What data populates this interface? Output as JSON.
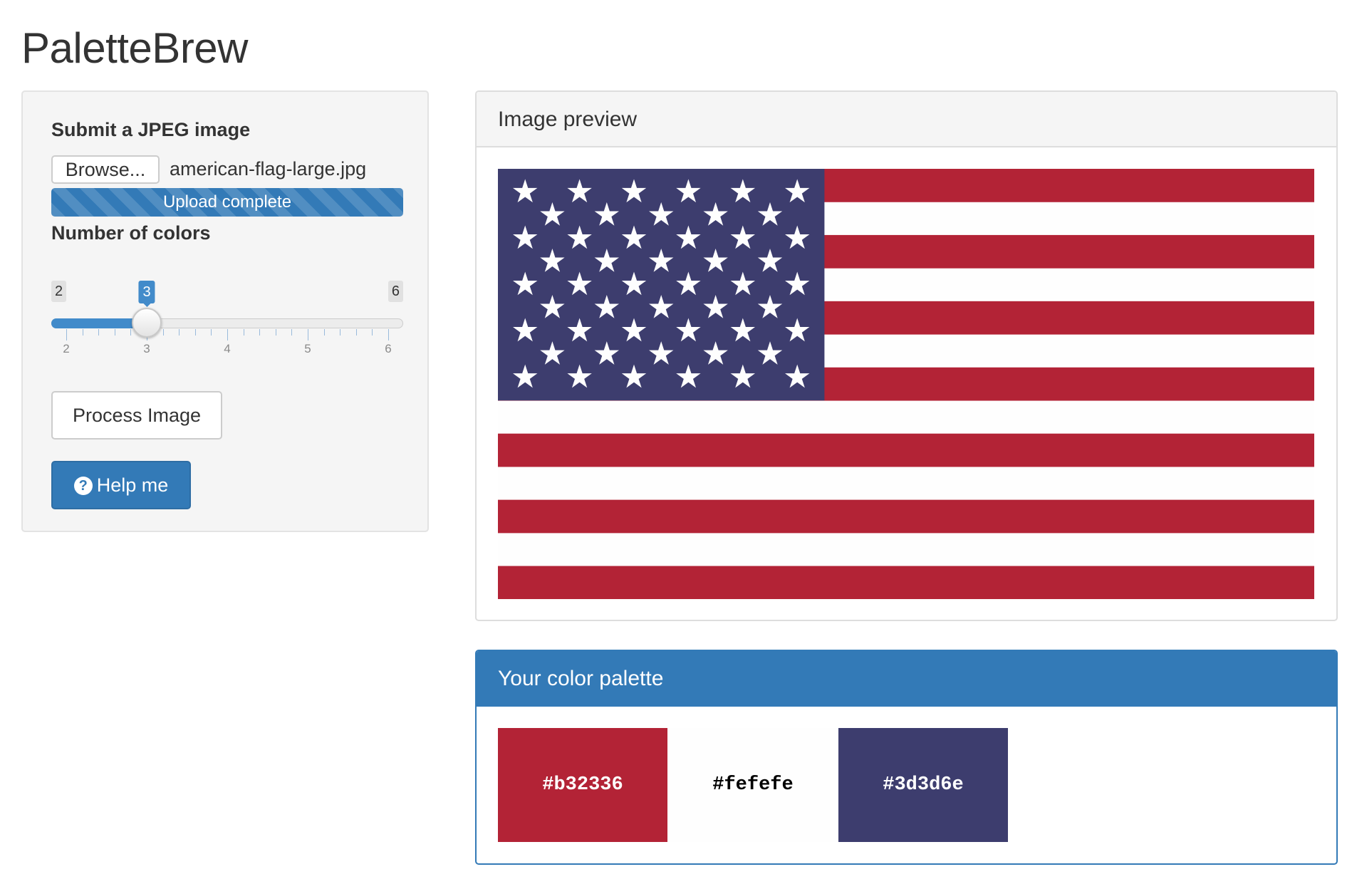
{
  "app": {
    "title": "PaletteBrew"
  },
  "sidebar": {
    "upload_label": "Submit a JPEG image",
    "browse_label": "Browse...",
    "file_name": "american-flag-large.jpg",
    "progress_text": "Upload complete",
    "progress_fraction": 1.0,
    "num_colors_label": "Number of colors",
    "slider": {
      "min": 2,
      "max": 6,
      "value": 3,
      "min_label": "2",
      "max_label": "6",
      "value_label": "3",
      "ticks": [
        "2",
        "3",
        "4",
        "5",
        "6"
      ]
    },
    "process_label": "Process Image",
    "help_label": "Help me",
    "help_icon": "question-circle-icon"
  },
  "preview": {
    "title": "Image preview",
    "flag_colors": {
      "red": "#b32336",
      "white": "#fefefe",
      "blue": "#3d3d6e"
    }
  },
  "palette": {
    "title": "Your color palette",
    "swatches": [
      {
        "hex": "#b32336",
        "label": "#b32336",
        "text_color": "#ffffff"
      },
      {
        "hex": "#fefefe",
        "label": "#fefefe",
        "text_color": "#000000"
      },
      {
        "hex": "#3d3d6e",
        "label": "#3d3d6e",
        "text_color": "#ffffff"
      }
    ]
  },
  "colors": {
    "primary": "#337ab7",
    "slider": "#428bca",
    "well": "#f5f5f5"
  }
}
